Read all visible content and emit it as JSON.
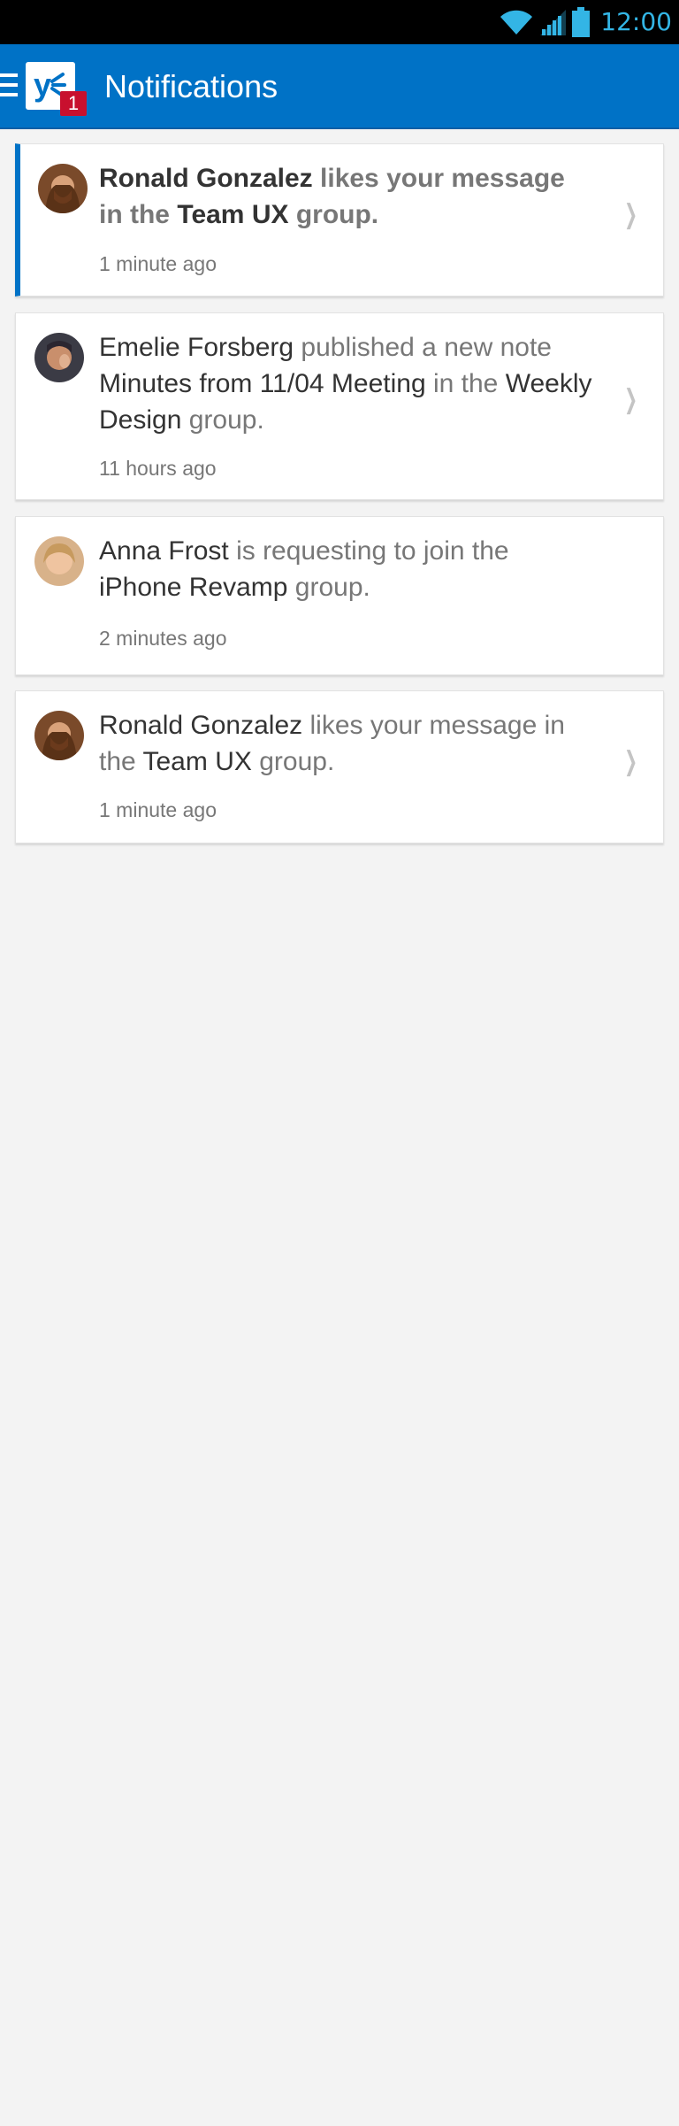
{
  "status_bar": {
    "time": "12:00",
    "icons": [
      "wifi-icon",
      "signal-icon",
      "battery-icon"
    ],
    "accent_color": "#33b5e5"
  },
  "app_bar": {
    "title": "Notifications",
    "badge_count": "1",
    "logo_letter": "y",
    "brand_color": "#0072c6"
  },
  "notifications": [
    {
      "unread": true,
      "actor": "Ronald Gonzalez",
      "parts": [
        " likes your message in the ",
        "Team UX",
        " group."
      ],
      "time": "1 minute ago",
      "chevron": true
    },
    {
      "unread": false,
      "actor": "Emelie Forsberg",
      "parts": [
        " published a new note ",
        "Minutes from 11/04 Meeting",
        " in the ",
        "Weekly Design",
        " group."
      ],
      "time": "11 hours ago",
      "chevron": true
    },
    {
      "unread": false,
      "actor": "Anna Frost",
      "parts": [
        " is requesting to join the ",
        "iPhone Revamp",
        " group."
      ],
      "time": "2 minutes ago",
      "chevron": false
    },
    {
      "unread": false,
      "actor": "Ronald Gonzalez",
      "parts": [
        " likes your message in the ",
        "Team UX",
        " group."
      ],
      "time": "1 minute ago",
      "chevron": true
    }
  ]
}
